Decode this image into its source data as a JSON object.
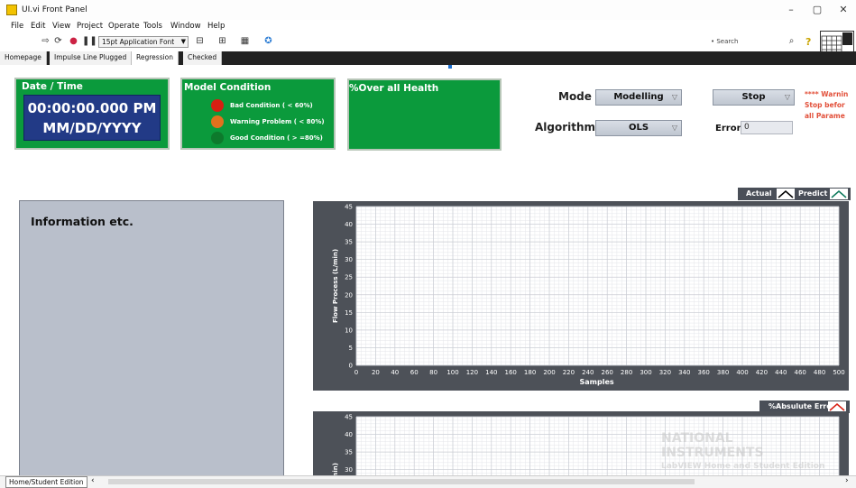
{
  "window": {
    "title": "UI.vi Front Panel",
    "minimize": "–",
    "restore": "▢",
    "close": "✕"
  },
  "menu": [
    "File",
    "Edit",
    "View",
    "Project",
    "Operate",
    "Tools",
    "Window",
    "Help"
  ],
  "toolbar": {
    "font": "15pt Application Font",
    "search_placeholder": "Search"
  },
  "tabs": [
    {
      "label": "Homepage"
    },
    {
      "label": "Impulse Line Plugged"
    },
    {
      "label": "Regression"
    },
    {
      "label": "Checked"
    }
  ],
  "active_tab": "Regression",
  "datetime": {
    "title": "Date / Time",
    "time": "00:00:00.000 PM",
    "date": "MM/DD/YYYY"
  },
  "model_condition": {
    "title": "Model Condition",
    "items": [
      {
        "label": "Bad Condition ( < 60%)",
        "color": "#d81f12"
      },
      {
        "label": "Warning Problem ( < 80%)",
        "color": "#e2711e"
      },
      {
        "label": "Good Condition ( > =80%)",
        "color": "#0d7a2c"
      }
    ]
  },
  "health": {
    "title": "%Over all Health"
  },
  "mode": {
    "label": "Mode",
    "value": "Modelling"
  },
  "algorithm": {
    "label": "Algorithm",
    "value": "OLS"
  },
  "stop": {
    "label": "Stop"
  },
  "warning": {
    "line1": "**** Warnin",
    "line2": "Stop befor",
    "line3": "all Parame"
  },
  "error": {
    "label": "Error",
    "value": "0"
  },
  "info": {
    "title": "Information etc."
  },
  "legend1": {
    "actual": "Actual",
    "predict": "Predict"
  },
  "legend2": {
    "label": "%Absulute Error"
  },
  "chart_data": [
    {
      "type": "line",
      "ylabel": "Flow Process (L/min)",
      "xlabel": "Samples",
      "xlim": [
        0,
        500
      ],
      "ylim": [
        0,
        45
      ],
      "xticks": [
        0,
        20,
        40,
        60,
        80,
        100,
        120,
        140,
        160,
        180,
        200,
        220,
        240,
        260,
        280,
        300,
        320,
        340,
        360,
        380,
        400,
        420,
        440,
        460,
        480,
        500
      ],
      "yticks": [
        0,
        5,
        10,
        15,
        20,
        25,
        30,
        35,
        40,
        45
      ],
      "series": [
        {
          "name": "Actual",
          "values": []
        },
        {
          "name": "Predict",
          "values": []
        }
      ],
      "grid": true
    },
    {
      "type": "line",
      "ylabel": "min)",
      "ylim": [
        0,
        45
      ],
      "yticks_visible": [
        30,
        35,
        40,
        45
      ],
      "series": [
        {
          "name": "%Absulute Error",
          "values": []
        }
      ],
      "grid": true
    }
  ],
  "status": {
    "tab": "Home/Student Edition"
  },
  "watermark": {
    "line1": "NATIONAL",
    "line2": "INSTRUMENTS",
    "line3": "LabVIEW Home and Student Edition"
  }
}
